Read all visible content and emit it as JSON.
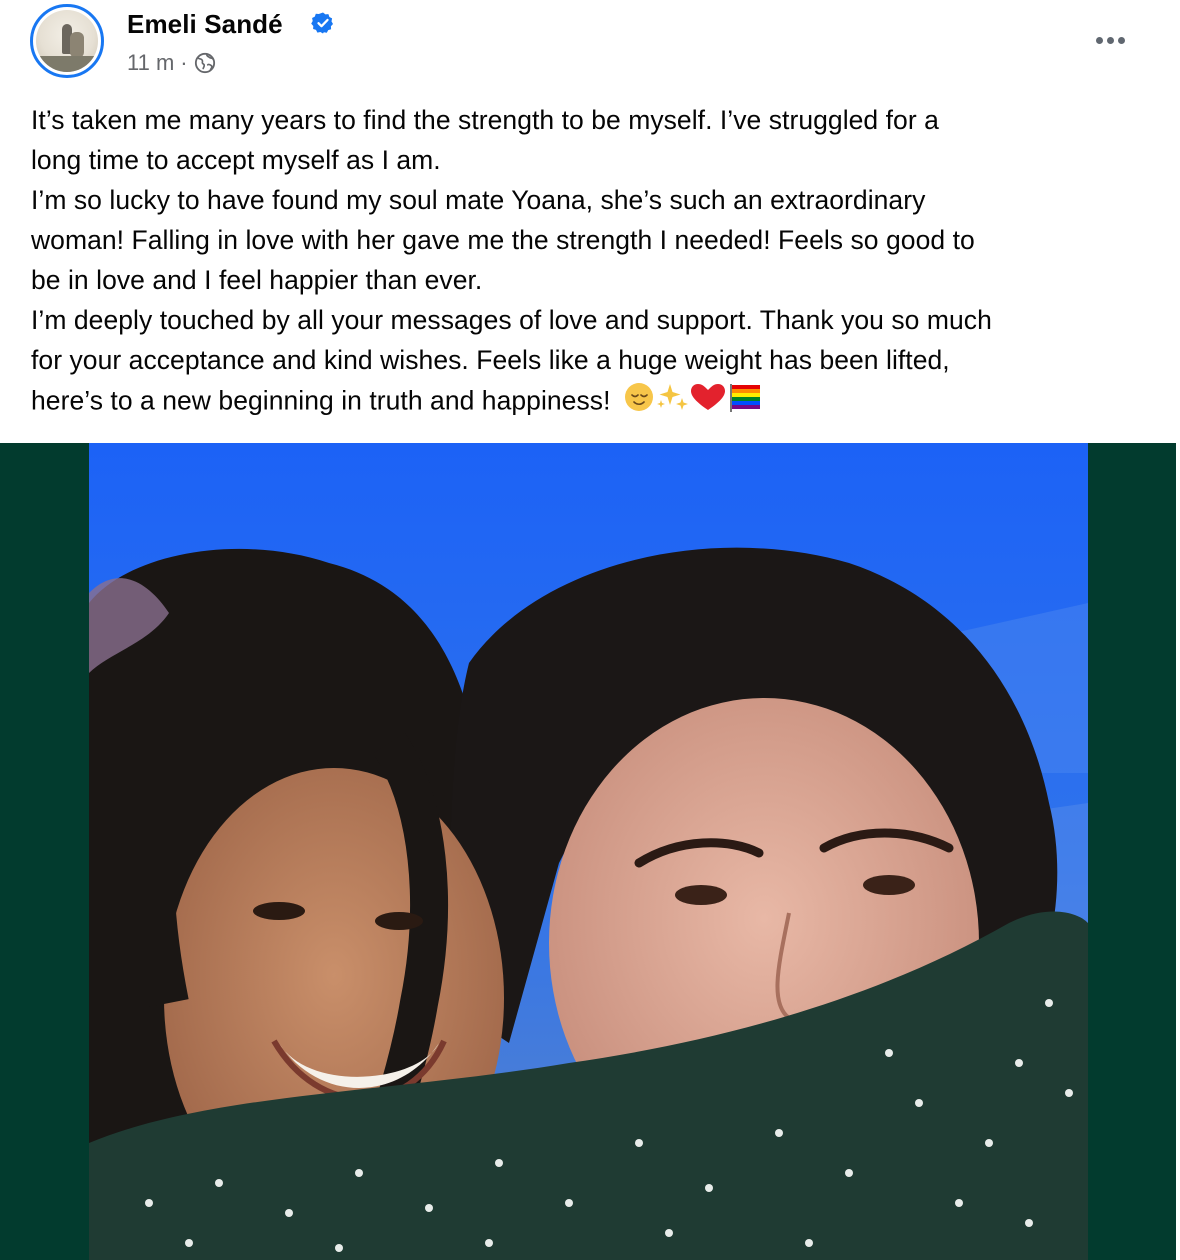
{
  "post": {
    "author": "Emeli Sandé",
    "timestamp": "11 m",
    "separator": "·",
    "audience_icon": "globe-icon",
    "verified_icon": "verified-badge-icon",
    "more_icon": "more-options-icon",
    "text_lines": [
      "It’s taken me many years to find the strength to be myself. I’ve struggled for a",
      "long time to accept myself as I am.",
      "I’m so lucky to have found my soul mate Yoana, she’s such an extraordinary",
      "woman! Falling in love with her gave me the strength I needed! Feels so good to",
      "be in love and I feel happier than ever.",
      "I’m deeply touched by all your messages of love and support. Thank you so much",
      "for your acceptance and kind wishes. Feels like a huge weight has been lifted,",
      "here’s to a new beginning in truth and happiness!"
    ],
    "emojis": "😌✨❤️🏳️‍🌈"
  },
  "colors": {
    "accent": "#1877f2",
    "meta_text": "#65676b",
    "photo_frame": "#023b2e",
    "photo_background": "#1f66f4"
  }
}
